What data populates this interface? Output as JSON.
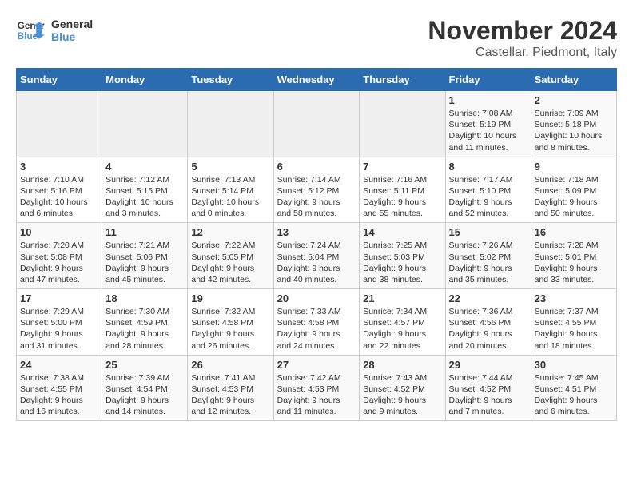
{
  "logo": {
    "text_general": "General",
    "text_blue": "Blue"
  },
  "header": {
    "month": "November 2024",
    "location": "Castellar, Piedmont, Italy"
  },
  "weekdays": [
    "Sunday",
    "Monday",
    "Tuesday",
    "Wednesday",
    "Thursday",
    "Friday",
    "Saturday"
  ],
  "weeks": [
    [
      {
        "day": "",
        "info": ""
      },
      {
        "day": "",
        "info": ""
      },
      {
        "day": "",
        "info": ""
      },
      {
        "day": "",
        "info": ""
      },
      {
        "day": "",
        "info": ""
      },
      {
        "day": "1",
        "info": "Sunrise: 7:08 AM\nSunset: 5:19 PM\nDaylight: 10 hours and 11 minutes."
      },
      {
        "day": "2",
        "info": "Sunrise: 7:09 AM\nSunset: 5:18 PM\nDaylight: 10 hours and 8 minutes."
      }
    ],
    [
      {
        "day": "3",
        "info": "Sunrise: 7:10 AM\nSunset: 5:16 PM\nDaylight: 10 hours and 6 minutes."
      },
      {
        "day": "4",
        "info": "Sunrise: 7:12 AM\nSunset: 5:15 PM\nDaylight: 10 hours and 3 minutes."
      },
      {
        "day": "5",
        "info": "Sunrise: 7:13 AM\nSunset: 5:14 PM\nDaylight: 10 hours and 0 minutes."
      },
      {
        "day": "6",
        "info": "Sunrise: 7:14 AM\nSunset: 5:12 PM\nDaylight: 9 hours and 58 minutes."
      },
      {
        "day": "7",
        "info": "Sunrise: 7:16 AM\nSunset: 5:11 PM\nDaylight: 9 hours and 55 minutes."
      },
      {
        "day": "8",
        "info": "Sunrise: 7:17 AM\nSunset: 5:10 PM\nDaylight: 9 hours and 52 minutes."
      },
      {
        "day": "9",
        "info": "Sunrise: 7:18 AM\nSunset: 5:09 PM\nDaylight: 9 hours and 50 minutes."
      }
    ],
    [
      {
        "day": "10",
        "info": "Sunrise: 7:20 AM\nSunset: 5:08 PM\nDaylight: 9 hours and 47 minutes."
      },
      {
        "day": "11",
        "info": "Sunrise: 7:21 AM\nSunset: 5:06 PM\nDaylight: 9 hours and 45 minutes."
      },
      {
        "day": "12",
        "info": "Sunrise: 7:22 AM\nSunset: 5:05 PM\nDaylight: 9 hours and 42 minutes."
      },
      {
        "day": "13",
        "info": "Sunrise: 7:24 AM\nSunset: 5:04 PM\nDaylight: 9 hours and 40 minutes."
      },
      {
        "day": "14",
        "info": "Sunrise: 7:25 AM\nSunset: 5:03 PM\nDaylight: 9 hours and 38 minutes."
      },
      {
        "day": "15",
        "info": "Sunrise: 7:26 AM\nSunset: 5:02 PM\nDaylight: 9 hours and 35 minutes."
      },
      {
        "day": "16",
        "info": "Sunrise: 7:28 AM\nSunset: 5:01 PM\nDaylight: 9 hours and 33 minutes."
      }
    ],
    [
      {
        "day": "17",
        "info": "Sunrise: 7:29 AM\nSunset: 5:00 PM\nDaylight: 9 hours and 31 minutes."
      },
      {
        "day": "18",
        "info": "Sunrise: 7:30 AM\nSunset: 4:59 PM\nDaylight: 9 hours and 28 minutes."
      },
      {
        "day": "19",
        "info": "Sunrise: 7:32 AM\nSunset: 4:58 PM\nDaylight: 9 hours and 26 minutes."
      },
      {
        "day": "20",
        "info": "Sunrise: 7:33 AM\nSunset: 4:58 PM\nDaylight: 9 hours and 24 minutes."
      },
      {
        "day": "21",
        "info": "Sunrise: 7:34 AM\nSunset: 4:57 PM\nDaylight: 9 hours and 22 minutes."
      },
      {
        "day": "22",
        "info": "Sunrise: 7:36 AM\nSunset: 4:56 PM\nDaylight: 9 hours and 20 minutes."
      },
      {
        "day": "23",
        "info": "Sunrise: 7:37 AM\nSunset: 4:55 PM\nDaylight: 9 hours and 18 minutes."
      }
    ],
    [
      {
        "day": "24",
        "info": "Sunrise: 7:38 AM\nSunset: 4:55 PM\nDaylight: 9 hours and 16 minutes."
      },
      {
        "day": "25",
        "info": "Sunrise: 7:39 AM\nSunset: 4:54 PM\nDaylight: 9 hours and 14 minutes."
      },
      {
        "day": "26",
        "info": "Sunrise: 7:41 AM\nSunset: 4:53 PM\nDaylight: 9 hours and 12 minutes."
      },
      {
        "day": "27",
        "info": "Sunrise: 7:42 AM\nSunset: 4:53 PM\nDaylight: 9 hours and 11 minutes."
      },
      {
        "day": "28",
        "info": "Sunrise: 7:43 AM\nSunset: 4:52 PM\nDaylight: 9 hours and 9 minutes."
      },
      {
        "day": "29",
        "info": "Sunrise: 7:44 AM\nSunset: 4:52 PM\nDaylight: 9 hours and 7 minutes."
      },
      {
        "day": "30",
        "info": "Sunrise: 7:45 AM\nSunset: 4:51 PM\nDaylight: 9 hours and 6 minutes."
      }
    ]
  ]
}
